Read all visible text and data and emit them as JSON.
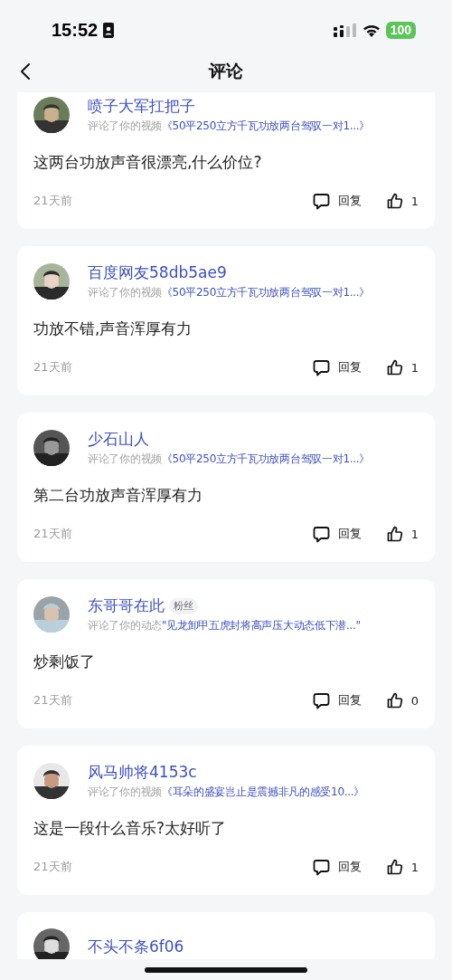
{
  "status_bar": {
    "time": "15:52",
    "battery": "100"
  },
  "header": {
    "title": "评论"
  },
  "comments": [
    {
      "user": "喷子大军扛把子",
      "action": "评论了你的视频",
      "target": "《50平250立方千瓦功放两台驾驭一对1...》",
      "text": "这两台功放声音很漂亮,什么价位?",
      "time": "21天前",
      "reply": "回复",
      "likes": "1"
    },
    {
      "user": "百度网友58db5ae9",
      "action": "评论了你的视频",
      "target": "《50平250立方千瓦功放两台驾驭一对1...》",
      "text": "功放不错,声音浑厚有力",
      "time": "21天前",
      "reply": "回复",
      "likes": "1"
    },
    {
      "user": "少石山人",
      "action": "评论了你的视频",
      "target": "《50平250立方千瓦功放两台驾驭一对1...》",
      "text": "第二台功放声音浑厚有力",
      "time": "21天前",
      "reply": "回复",
      "likes": "1"
    },
    {
      "user": "东哥哥在此",
      "badge": "粉丝",
      "action": "评论了你的动态",
      "target": "\"见龙卸甲五虎封将高声压大动态低下潜...\"",
      "text": "炒剩饭了",
      "time": "21天前",
      "reply": "回复",
      "likes": "0"
    },
    {
      "user": "风马帅将4153c",
      "action": "评论了你的视频",
      "target": "《耳朵的盛宴岂止是震撼非凡的感受10...》",
      "text": "这是一段什么音乐?太好听了",
      "time": "21天前",
      "reply": "回复",
      "likes": "1"
    },
    {
      "user": "不头不条6f06"
    }
  ]
}
